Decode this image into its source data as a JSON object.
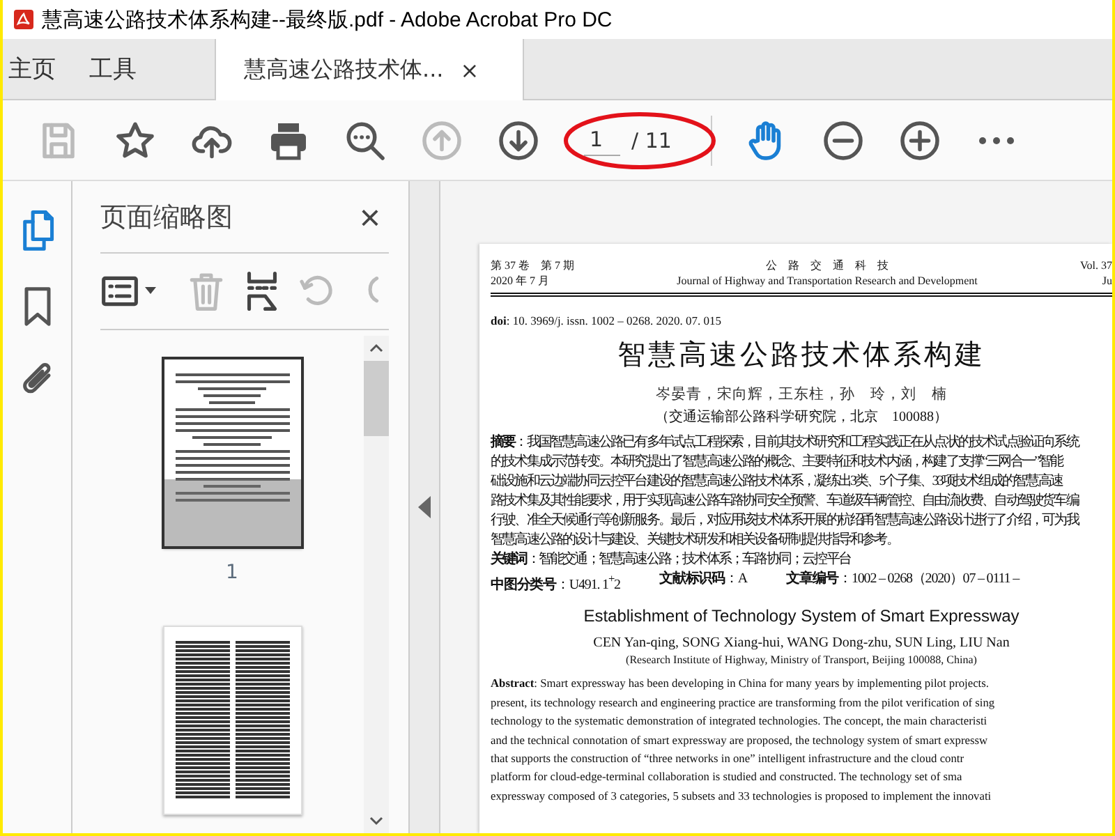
{
  "window": {
    "title": "慧高速公路技术体系构建--最终版.pdf - Adobe Acrobat Pro DC"
  },
  "tabs": [
    {
      "label": "主页",
      "selected": false,
      "kind": "nav"
    },
    {
      "label": "工具",
      "selected": false,
      "kind": "nav"
    },
    {
      "label": "慧高速公路技术体...",
      "selected": true,
      "kind": "document",
      "close": "×"
    }
  ],
  "toolbar": {
    "tools": [
      {
        "kind": "save",
        "disabled": true,
        "selected": false
      },
      {
        "kind": "star",
        "disabled": false,
        "selected": false
      },
      {
        "kind": "cloud",
        "disabled": false,
        "selected": false
      },
      {
        "kind": "print",
        "disabled": false,
        "selected": false
      },
      {
        "kind": "find",
        "disabled": false,
        "selected": false
      },
      {
        "kind": "prev",
        "disabled": true,
        "selected": false
      },
      {
        "kind": "next",
        "disabled": false,
        "selected": false
      },
      {
        "kind": "page",
        "value": "1",
        "total": "/ 11"
      },
      {
        "kind": "divider"
      },
      {
        "kind": "hand",
        "disabled": false,
        "selected": true
      },
      {
        "kind": "zoomout",
        "disabled": false,
        "selected": false
      },
      {
        "kind": "zoomin",
        "disabled": false,
        "selected": false
      },
      {
        "kind": "more",
        "disabled": false,
        "selected": false
      }
    ]
  },
  "rail": [
    {
      "kind": "pages",
      "selected": true
    },
    {
      "kind": "bookmark",
      "selected": false
    },
    {
      "kind": "attach",
      "selected": false
    }
  ],
  "panel": {
    "title": "页面缩略图",
    "close": "×",
    "tools": [
      {
        "kind": "options",
        "disabled": false
      },
      {
        "kind": "trash",
        "disabled": true
      },
      {
        "kind": "insert",
        "disabled": false
      },
      {
        "kind": "rotate",
        "disabled": true
      },
      {
        "kind": "rotate2",
        "disabled": true
      }
    ],
    "thumbnails": [
      {
        "label": "1",
        "selected": true,
        "kind": "cover"
      },
      {
        "kind": "columns",
        "selected": false
      }
    ]
  },
  "document": {
    "header_left": [
      "第 37 卷　第 7 期",
      "2020 年 7 月"
    ],
    "header_center": [
      "公　路　交　通　科　技",
      "Journal of Highway and Transportation Research and Development"
    ],
    "header_right": [
      "Vol. 37",
      "Ju"
    ],
    "doi": "**doi**: 10. 3969/j. issn. 1002 – 0268. 2020. 07. 015",
    "title": "智慧高速公路技术体系构建",
    "authors": "岑晏青，宋向辉，王东柱，孙　玲，刘　楠",
    "affiliation": "（交通运输部公路科学研究院，北京　100088）",
    "abstract_lines": [
      "**摘要**：我国智慧高速公路已有多年试点工程探索，目前其技术研究和工程实践正在从点状的技术试点验证向系统",
      "的技术集成示范转变。本研究提出了智慧高速公路的概念、主要特征和技术内涵，构建了支撑“三网合一”智能",
      "础设施和云边端协同云控平台建设的智慧高速公路技术体系，凝练出3类、5个子集、33项技术组成的智慧高速",
      "路技术集及其性能要求，用于实现高速公路车路协同安全预警、车道级车辆管控、自由流收费、自动驾驶货车编",
      "行驶、准全天候通行等创新服务。最后，对应用该技术体系开展的杭绍甬智慧高速公路设计进行了介绍，可为我",
      "智慧高速公路的设计与建设、关键技术研发和相关设备研制提供指导和参考。"
    ],
    "keywords": "**关键词**：智能交通；智慧高速公路；技术体系；车路协同；云控平台",
    "classification": [
      "**中图分类号**：U491. 1$^{+}$2",
      "**文献标识码**：A",
      "**文章编号**：1002 – 0268（2020）07 – 0111 –"
    ],
    "en_title": "Establishment of Technology System of Smart Expressway",
    "en_authors": "CEN Yan-qing, SONG Xiang-hui, WANG Dong-zhu, SUN Ling, LIU Nan",
    "en_affiliation": "(Research Institute of Highway, Ministry of Transport, Beijing 100088, China)",
    "en_abstract_lines": [
      "**Abstract**: Smart expressway has been developing in China for many years by implementing pilot projects.",
      "present, its technology research and engineering practice are transforming from the pilot verification of sing",
      "technology to the systematic demonstration of integrated technologies. The concept, the main characteristi",
      "and the technical connotation of smart expressway are proposed, the technology system of smart expressw",
      "that supports the construction of “three networks in one” intelligent infrastructure and the cloud contr",
      "platform for cloud-edge-terminal collaboration is studied and constructed. The technology set of sma",
      "expressway composed of 3 categories, 5 subsets and 33 technologies is proposed to implement the innovati"
    ]
  }
}
